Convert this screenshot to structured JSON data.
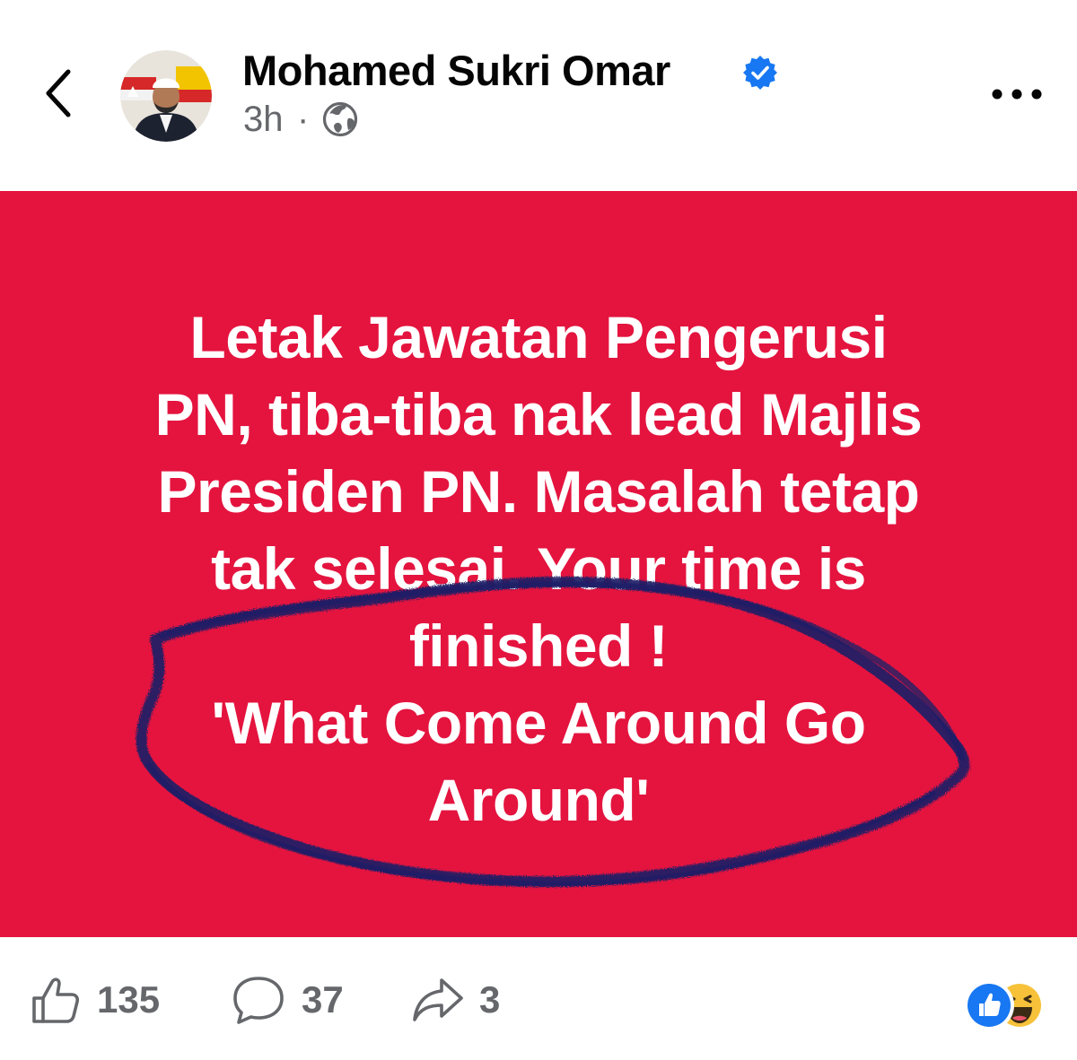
{
  "header": {
    "author_name": "Mohamed Sukri Omar",
    "post_time": "3h",
    "separator": "·",
    "verified": true
  },
  "post": {
    "lines": [
      "Letak Jawatan Pengerusi",
      "PN, tiba-tiba nak lead Majlis",
      "Presiden PN. Masalah tetap",
      "tak selesai. Your time is",
      "finished !",
      "'What Come Around Go",
      "Around'"
    ],
    "background_color": "#e4143f",
    "text_color": "#ffffff",
    "annotation_color": "#1e1f66"
  },
  "footer": {
    "likes": "135",
    "comments": "37",
    "shares": "3",
    "reaction_icons": [
      "like-reaction-icon",
      "haha-reaction-icon"
    ]
  },
  "icons": {
    "back": "chevron-left-icon",
    "verified": "verified-badge-icon",
    "audience": "globe-icon",
    "more": "more-horizontal-icon",
    "like": "thumbs-up-icon",
    "comment": "comment-bubble-icon",
    "share": "share-arrow-icon"
  },
  "colors": {
    "verified_blue": "#1877f2",
    "secondary_text": "#65676b",
    "primary_text": "#050505"
  }
}
